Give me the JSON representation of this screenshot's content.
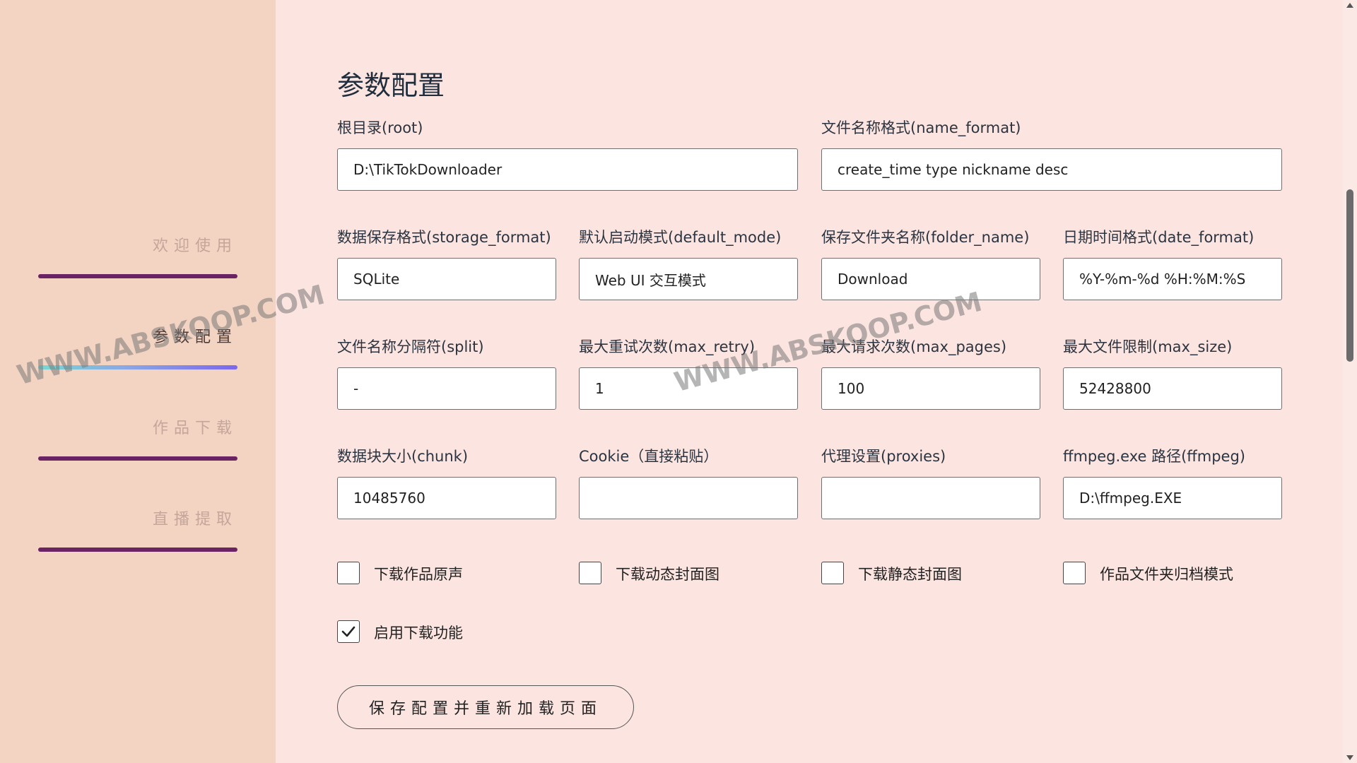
{
  "sidebar": {
    "items": [
      {
        "label": "欢迎使用"
      },
      {
        "label": "参数配置"
      },
      {
        "label": "作品下载"
      },
      {
        "label": "直播提取"
      }
    ]
  },
  "main": {
    "title": "参数配置",
    "fields": {
      "root": {
        "label": "根目录(root)",
        "value": "D:\\TikTokDownloader"
      },
      "name_format": {
        "label": "文件名称格式(name_format)",
        "value": "create_time type nickname desc"
      },
      "storage_format": {
        "label": "数据保存格式(storage_format)",
        "value": "SQLite"
      },
      "default_mode": {
        "label": "默认启动模式(default_mode)",
        "value": "Web UI 交互模式"
      },
      "folder_name": {
        "label": "保存文件夹名称(folder_name)",
        "value": "Download"
      },
      "date_format": {
        "label": "日期时间格式(date_format)",
        "value": "%Y-%m-%d %H:%M:%S"
      },
      "split": {
        "label": "文件名称分隔符(split)",
        "value": "-"
      },
      "max_retry": {
        "label": "最大重试次数(max_retry)",
        "value": "1"
      },
      "max_pages": {
        "label": "最大请求次数(max_pages)",
        "value": "100"
      },
      "max_size": {
        "label": "最大文件限制(max_size)",
        "value": "52428800"
      },
      "chunk": {
        "label": "数据块大小(chunk)",
        "value": "10485760"
      },
      "cookie": {
        "label": "Cookie（直接粘贴）",
        "value": ""
      },
      "proxies": {
        "label": "代理设置(proxies)",
        "value": ""
      },
      "ffmpeg": {
        "label": "ffmpeg.exe 路径(ffmpeg)",
        "value": "D:\\ffmpeg.EXE"
      }
    },
    "checkboxes": {
      "music": {
        "label": "下载作品原声",
        "checked": false
      },
      "dynamic_cover": {
        "label": "下载动态封面图",
        "checked": false
      },
      "original_cover": {
        "label": "下载静态封面图",
        "checked": false
      },
      "folder_mode": {
        "label": "作品文件夹归档模式",
        "checked": false
      },
      "download": {
        "label": "启用下载功能",
        "checked": true
      }
    },
    "save_button": "保存配置并重新加载页面"
  },
  "watermark": {
    "text": "WWW.ABSKOOP.COM"
  }
}
